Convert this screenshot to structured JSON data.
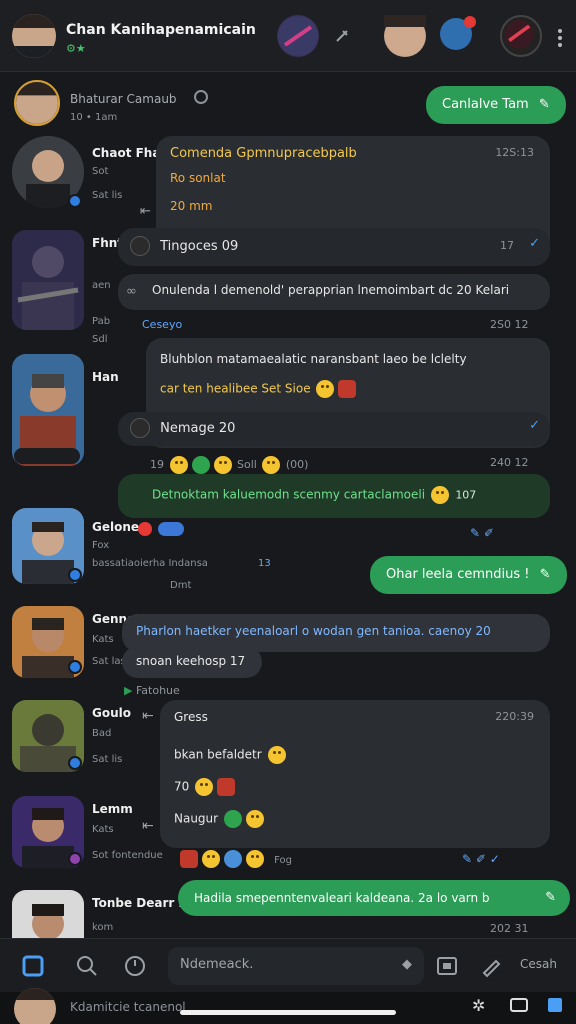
{
  "header": {
    "title": "Chan Kanihapenamicain",
    "subtitle_badges": "⚙︎★"
  },
  "pinned": {
    "name": "Bhaturar Camaub",
    "sub": "10 • 1am"
  },
  "primary_action": {
    "label": "Canlalve Tam",
    "icon": "edit-icon"
  },
  "chats": [
    {
      "name": "Chaot Fhan",
      "sub1": "Sot",
      "sub2": "Sat lis"
    },
    {
      "name": "Fhnt",
      "sub1": "aen",
      "sub2": "Pab",
      "sub3": "Sdl"
    },
    {
      "name": "Han",
      "sub1": ""
    },
    {
      "name": "Gelone",
      "sub1": "Fox",
      "sub2": "bassatiaoierha Indansa",
      "sub3": "13",
      "sub4": "Dmt"
    },
    {
      "name": "Gennet",
      "sub1": "Kats",
      "sub2": "Sat las"
    },
    {
      "name": "Goulo",
      "sub1": "Bad",
      "sub2": "Sat lis"
    },
    {
      "name": "Lemm",
      "sub1": "Kats",
      "sub2": "Sot fontendue",
      "sub3": "Fog"
    },
    {
      "name": "Tonbe Dearr bir",
      "sub1": "kom"
    }
  ],
  "messages": {
    "m1": {
      "title": "Comenda Gpmnupracebpalb",
      "time": "12S:13",
      "line1": "Ro sonlat",
      "line2": "20 mm",
      "sender": "Tingoces 09",
      "stat": "17"
    },
    "m2": {
      "text": "Onulenda l demenold' perapprian lnemoimbart dc 20 Kelari"
    },
    "m3": {
      "label": "Ceseyo",
      "time": "2S0 12"
    },
    "m4": {
      "line1": "Bluhblon matamaealatic naransbant laeo be lclelty",
      "line2": "car ten healibee Set Sioe",
      "sender": "Nemage 20"
    },
    "m5": {
      "meta": "19",
      "meta2": "Soll",
      "meta3": "(00)",
      "time": "240 12"
    },
    "m6": {
      "text": "Detnoktam kaluemodn scenmy cartaclamoeli",
      "count": "107"
    },
    "m7": {
      "text": "Ohar leela cemndius !"
    },
    "m8": {
      "text": "Pharlon haetker yeenaloarl o wodan gen tanioa. caenoy 20",
      "sub": "snoan keehosp 17"
    },
    "m9": {
      "label": "Fatohue"
    },
    "m10": {
      "title": "Gress",
      "time": "220:39",
      "line1": "bkan befaldetr",
      "line2": "70",
      "line3": "Naugur"
    },
    "m11": {
      "text": "Hadila smepenntenvaleari kaldeana. 2a lo varn b"
    },
    "m12": {
      "time": "202 31"
    }
  },
  "bottombar": {
    "search_placeholder": "Ndemeack.",
    "action_label": "Cesah"
  },
  "footer": {
    "name": "Kdamitcie tcanenol"
  },
  "colors": {
    "accent_green": "#2c9d56",
    "bubble": "#2a2d31",
    "background": "#17191c",
    "link_blue": "#4a9ff5"
  }
}
